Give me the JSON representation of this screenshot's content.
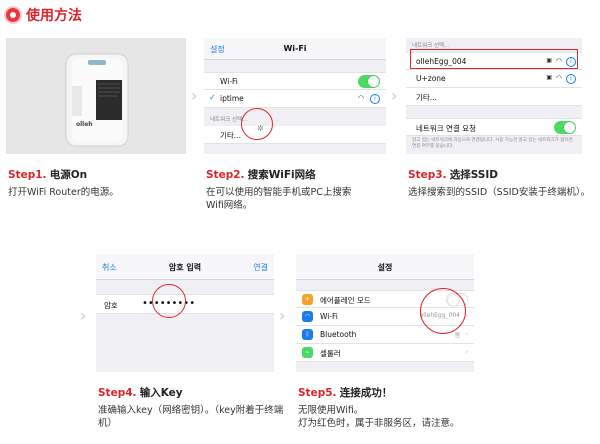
{
  "page": {
    "title": "使用方法"
  },
  "step1": {
    "step": "Step1.",
    "heading": "电源On",
    "body": "打开WiFi Router的电源。",
    "device_label": "olleh"
  },
  "step2": {
    "step": "Step2.",
    "heading": "搜索WiFi网络",
    "body_line1": "在可以使用的智能手机或PC上搜索",
    "body_line2": "Wifi网络。",
    "nav_back": "설정",
    "nav_title": "Wi-Fi",
    "wifi_label": "Wi-Fi",
    "network": "iptime",
    "section": "네트워크 선택...",
    "other": "기타..."
  },
  "step3": {
    "step": "Step3.",
    "heading": "选择SSID",
    "body": "选择搜索到的SSID（SSID安装于终端机）。",
    "section": "네트워크 선택...",
    "network1": "ollehEgg_004",
    "network2": "U+zone",
    "other": "기타...",
    "ask_join": "네트워크 연결 요청",
    "footnote": "알고 있는 네트워크에 자동으로 연결됩니다. 사용 가능한 알고 있는 네트워크가 없으면 연결 여부를 묻습니다."
  },
  "step4": {
    "step": "Step4.",
    "heading": "输入Key",
    "body_line1": "准确输入key（网络密钥）。（key附着于终端",
    "body_line2": "机）",
    "nav_cancel": "취소",
    "nav_title": "암호 입력",
    "nav_join": "연결",
    "password_label": "암호",
    "password_value": "•••••••••"
  },
  "step5": {
    "step": "Step5.",
    "heading": "连接成功！",
    "body_line1": "无限使用Wifi。",
    "body_line2": "灯为红色时，属于非服务区，请注意。",
    "nav_title": "설정",
    "airplane": "에어플레인 모드",
    "wifi_label": "Wi-Fi",
    "wifi_value": "ollehEgg_004",
    "bluetooth": "Bluetooth",
    "bluetooth_value": "켬",
    "cellular": "셀룰러"
  },
  "colors": {
    "accent": "#d9262c",
    "ios_blue": "#1a7cf0",
    "toggle_green": "#4cd964"
  }
}
